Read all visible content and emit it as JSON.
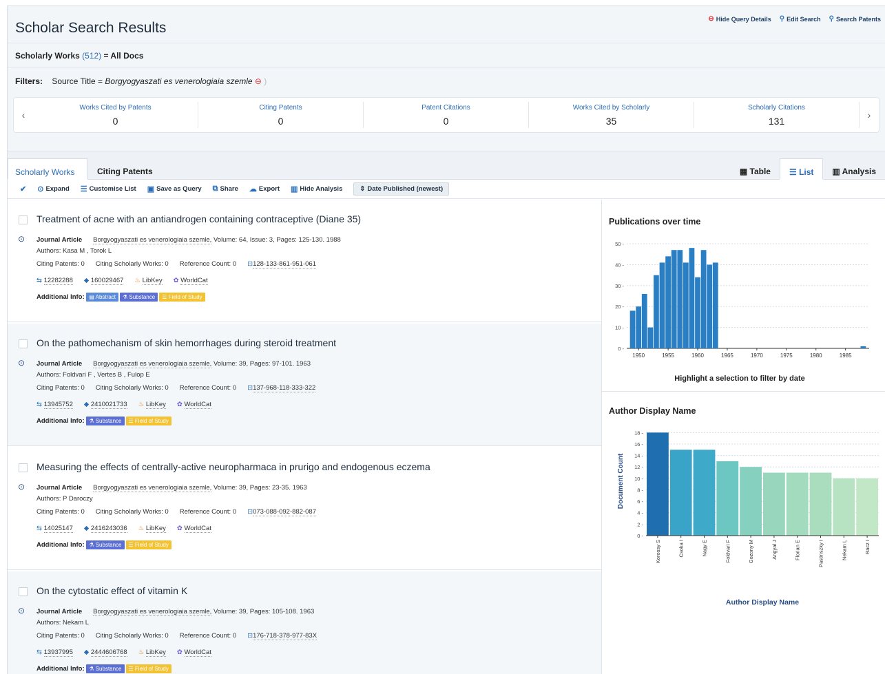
{
  "header": {
    "title": "Scholar Search Results",
    "actions": [
      "Hide Query Details",
      "Edit Search",
      "Search Patents"
    ],
    "works_label": "Scholarly Works",
    "works_count": "(512)",
    "works_suffix": "= All Docs",
    "filters_label": "Filters:",
    "filter_field": "Source Title =",
    "filter_value": "Borgyogyaszati es venerologiaia szemle"
  },
  "metrics": [
    {
      "label": "Works Cited by Patents",
      "value": "0"
    },
    {
      "label": "Citing Patents",
      "value": "0"
    },
    {
      "label": "Patent Citations",
      "value": "0"
    },
    {
      "label": "Works Cited by Scholarly",
      "value": "35"
    },
    {
      "label": "Scholarly Citations",
      "value": "131"
    }
  ],
  "tabs": {
    "active": "Scholarly Works",
    "other": "Citing Patents"
  },
  "views": [
    "Table",
    "List",
    "Analysis"
  ],
  "toolbar": {
    "expand": "Expand",
    "customise": "Customise List",
    "save": "Save as Query",
    "share": "Share",
    "export": "Export",
    "hide_analysis": "Hide Analysis",
    "sort": "Date Published (newest)"
  },
  "labels": {
    "type": "Journal Article",
    "citing_patents": "Citing Patents:",
    "citing_scholarly": "Citing Scholarly Works:",
    "reference_count": "Reference Count:",
    "additional_info": "Additional Info:",
    "libkey": "LibKey",
    "worldcat": "WorldCat",
    "abstract": "Abstract",
    "substance": "Substance",
    "field_of_study": "Field of Study"
  },
  "results": [
    {
      "title": "Treatment of acne with an antiandrogen containing contraceptive (Diane 35)",
      "journal": "Borgyogyaszati es venerologiaia szemle,",
      "details": "Volume: 64,  Issue: 3,  Pages: 125-130.  1988",
      "authors": "Authors: Kasa M , Torok L",
      "citing_patents": "0",
      "citing_scholarly": "0",
      "reference_count": "0",
      "lens_id": "128-133-861-951-061",
      "pmid": "12282288",
      "magid": "160029467",
      "has_abstract": true
    },
    {
      "title": "On the pathomechanism of skin hemorrhages during steroid treatment",
      "journal": "Borgyogyaszati es venerologiaia szemle,",
      "details": "Volume: 39,  Pages: 97-101.  1963",
      "authors": "Authors: Foldvari F , Vertes B , Fulop E",
      "citing_patents": "0",
      "citing_scholarly": "0",
      "reference_count": "0",
      "lens_id": "137-968-118-333-322",
      "pmid": "13945752",
      "magid": "2410021733",
      "has_abstract": false
    },
    {
      "title": "Measuring the effects of centrally-active neuropharmaca in prurigo and endogenous eczema",
      "journal": "Borgyogyaszati es venerologiaia szemle,",
      "details": "Volume: 39,  Pages: 23-35.  1963",
      "authors": "Authors: P Daroczy",
      "citing_patents": "0",
      "citing_scholarly": "0",
      "reference_count": "0",
      "lens_id": "073-088-092-882-087",
      "pmid": "14025147",
      "magid": "2416243036",
      "has_abstract": false
    },
    {
      "title": "On the cytostatic effect of vitamin K",
      "journal": "Borgyogyaszati es venerologiaia szemle,",
      "details": "Volume: 39,  Pages: 105-108.  1963",
      "authors": "Authors: Nekam L",
      "citing_patents": "0",
      "citing_scholarly": "0",
      "reference_count": "0",
      "lens_id": "176-718-378-977-83X",
      "pmid": "13937995",
      "magid": "2444606768",
      "has_abstract": false
    }
  ],
  "publications_panel": {
    "title": "Publications over time",
    "hint": "Highlight a selection to filter by date"
  },
  "author_panel": {
    "title": "Author Display Name"
  },
  "chart_data": [
    {
      "type": "bar",
      "title": "Publications over time",
      "x": [
        1949,
        1950,
        1951,
        1952,
        1953,
        1954,
        1955,
        1956,
        1957,
        1958,
        1959,
        1960,
        1961,
        1962,
        1963,
        1988
      ],
      "values": [
        18,
        20,
        26,
        10,
        35,
        41,
        44,
        47,
        47,
        41,
        48,
        34,
        47,
        40,
        41,
        1
      ],
      "xticks": [
        1950,
        1955,
        1960,
        1965,
        1970,
        1975,
        1980,
        1985
      ],
      "xlim": [
        1948,
        1989
      ],
      "ylim": [
        0,
        52
      ],
      "yticks": [
        0,
        10,
        20,
        30,
        40,
        50
      ],
      "grid": true,
      "color": "#2a7fc4"
    },
    {
      "type": "bar",
      "title": "Author Display Name",
      "xlabel": "Author Display Name",
      "ylabel": "Document Count",
      "categories": [
        "Korossy S",
        "Csoka I",
        "Nagy E",
        "Foldvari F",
        "Gozony M",
        "Angyal J",
        "Florian E",
        "Pastinszky I",
        "Nekam L",
        "Racz I"
      ],
      "values": [
        18,
        15,
        15,
        13,
        12,
        11,
        11,
        11,
        10,
        10
      ],
      "ylim": [
        0,
        19
      ],
      "yticks": [
        0,
        2,
        4,
        6,
        8,
        10,
        12,
        14,
        16,
        18
      ],
      "grid": true,
      "colors": [
        "#1f6fb0",
        "#3aa3c8",
        "#3ea9c9",
        "#6cc6c1",
        "#86d0bf",
        "#98d7bd",
        "#a2dbbd",
        "#a9ddbe",
        "#b7e3c2",
        "#c1e7c6"
      ]
    }
  ]
}
